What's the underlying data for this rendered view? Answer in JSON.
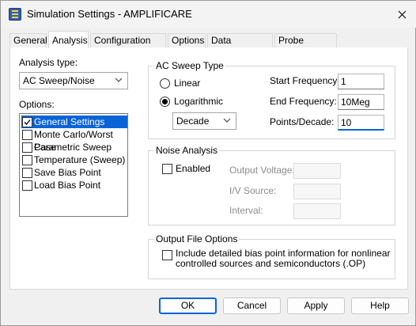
{
  "window": {
    "title": "Simulation Settings - AMPLIFICARE"
  },
  "tabs": [
    {
      "label": "General",
      "active": false
    },
    {
      "label": "Analysis",
      "active": true
    },
    {
      "label": "Configuration Files",
      "active": false
    },
    {
      "label": "Options",
      "active": false
    },
    {
      "label": "Data Collection",
      "active": false
    },
    {
      "label": "Probe Window",
      "active": false
    }
  ],
  "left": {
    "analysis_type_label": "Analysis type:",
    "analysis_type_value": "AC Sweep/Noise",
    "options_label": "Options:",
    "options": [
      {
        "label": "General Settings",
        "checked": true,
        "selected": true
      },
      {
        "label": "Monte Carlo/Worst Case",
        "checked": false,
        "selected": false
      },
      {
        "label": "Parametric Sweep",
        "checked": false,
        "selected": false
      },
      {
        "label": "Temperature (Sweep)",
        "checked": false,
        "selected": false
      },
      {
        "label": "Save Bias Point",
        "checked": false,
        "selected": false
      },
      {
        "label": "Load Bias Point",
        "checked": false,
        "selected": false
      }
    ]
  },
  "ac_sweep": {
    "group_title": "AC Sweep Type",
    "linear_label": "Linear",
    "log_label": "Logarithmic",
    "selected": "Logarithmic",
    "log_scale_value": "Decade",
    "start_freq_label": "Start Frequency:",
    "start_freq_value": "1",
    "end_freq_label": "End Frequency:",
    "end_freq_value": "10Meg",
    "points_label": "Points/Decade:",
    "points_value": "10"
  },
  "noise": {
    "group_title": "Noise Analysis",
    "enabled_label": "Enabled",
    "enabled": false,
    "output_voltage_label": "Output Voltage:",
    "iv_source_label": "I/V Source:",
    "interval_label": "Interval:"
  },
  "output_file": {
    "group_title": "Output File Options",
    "option_line1": "Include detailed bias point information for nonlinear",
    "option_line2": "controlled sources and semiconductors (.OP)",
    "checked": false
  },
  "buttons": {
    "ok": "OK",
    "cancel": "Cancel",
    "apply": "Apply",
    "help": "Help"
  },
  "colors": {
    "accent": "#0a64d8"
  }
}
